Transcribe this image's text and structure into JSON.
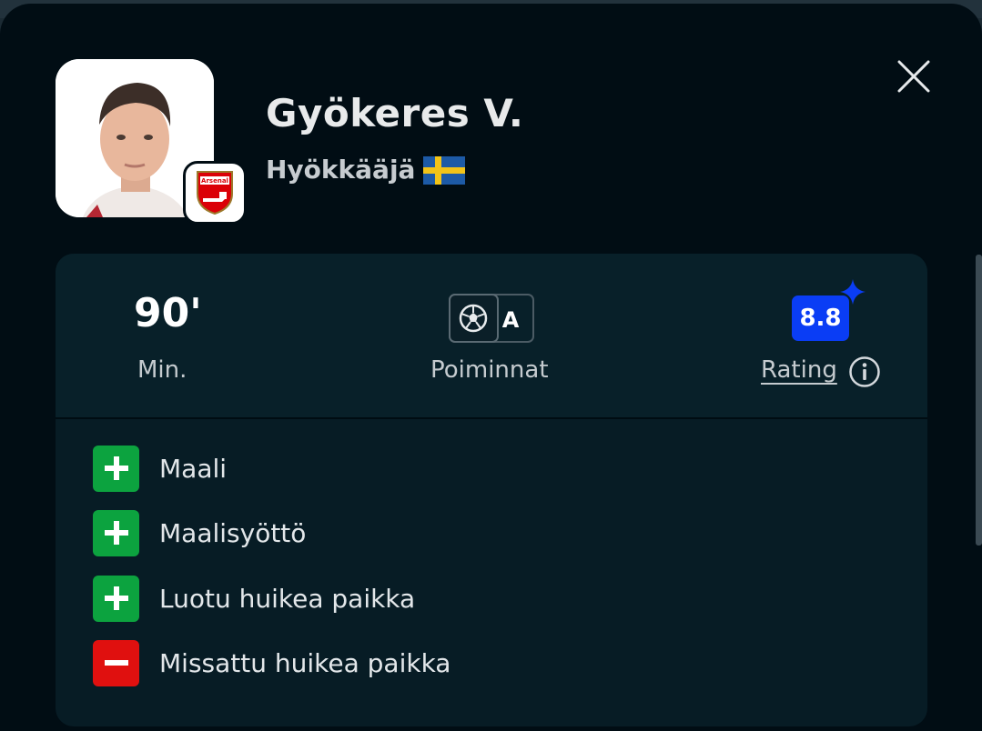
{
  "player": {
    "name": "Gyökeres V.",
    "position": "Hyökkääjä",
    "team_badge_text": "Arsenal",
    "nationality_flag_colors": {
      "blue": "#1d5aa6",
      "yellow": "#f2c318"
    }
  },
  "stats": {
    "minutes_value": "90'",
    "minutes_label": "Min.",
    "picks_letter": "A",
    "picks_label": "Poiminnat",
    "rating_value": "8.8",
    "rating_label": "Rating"
  },
  "events": [
    {
      "type": "plus",
      "label": "Maali"
    },
    {
      "type": "plus",
      "label": "Maalisyöttö"
    },
    {
      "type": "plus",
      "label": "Luotu huikea paikka"
    },
    {
      "type": "minus",
      "label": "Missattu huikea paikka"
    }
  ],
  "colors": {
    "modal_bg": "#010d14",
    "card_bg": "#082029",
    "rating_blue": "#0a3df5",
    "positive_green": "#0ca33f",
    "negative_red": "#e0100f"
  },
  "icons": {
    "close": "close-icon",
    "ball": "football-icon",
    "info": "info-icon",
    "sparkle": "sparkle-icon"
  }
}
